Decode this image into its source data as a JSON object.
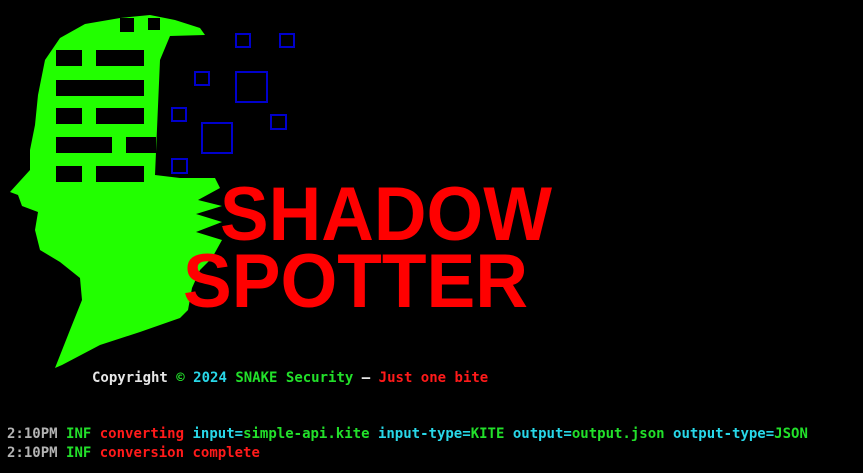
{
  "banner": {
    "title_line1": "SHADOW",
    "title_line2": "SPOTTER",
    "icon": "head-silhouette-icon",
    "colors": {
      "head": "#22ff00",
      "title": "#ff0000",
      "squares": "#0000cc",
      "background": "#000000"
    }
  },
  "copyright": {
    "word": "Copyright",
    "symbol": "©",
    "year": "2024",
    "company": "SNAKE Security",
    "dash": "–",
    "slogan": "Just one bite"
  },
  "logs": [
    {
      "time": "2:10PM",
      "level": "INF",
      "message": "converting",
      "fields": [
        {
          "key": "input",
          "value": "simple-api.kite"
        },
        {
          "key": "input-type",
          "value": "KITE"
        },
        {
          "key": "output",
          "value": "output.json"
        },
        {
          "key": "output-type",
          "value": "JSON"
        }
      ]
    },
    {
      "time": "2:10PM",
      "level": "INF",
      "message": "conversion complete"
    }
  ]
}
